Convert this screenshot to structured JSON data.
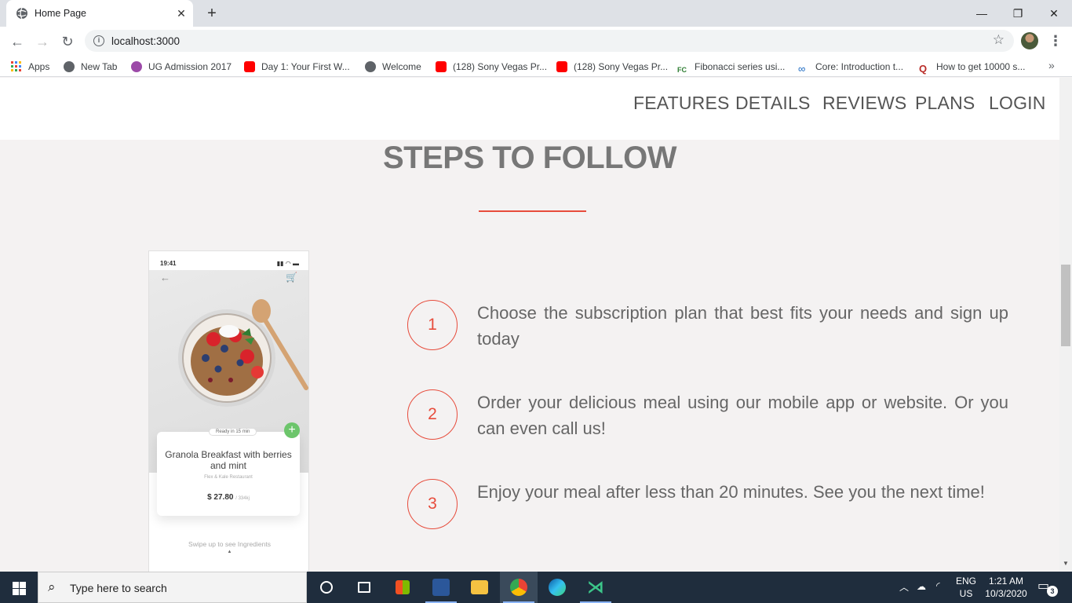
{
  "browser": {
    "tab_title": "Home Page",
    "new_tab_symbol": "+",
    "url": "localhost:3000",
    "bookmarks": [
      {
        "label": "Apps",
        "icon": "apps-grid-icon",
        "color": "#e94235"
      },
      {
        "label": "New Tab",
        "icon": "globe-icon",
        "color": "#5f6368"
      },
      {
        "label": "UG Admission 2017",
        "icon": "university-icon",
        "color": "#9c27b0"
      },
      {
        "label": "Day 1: Your First W...",
        "icon": "youtube-icon",
        "color": "#ff0000"
      },
      {
        "label": "Welcome",
        "icon": "globe-icon",
        "color": "#5f6368"
      },
      {
        "label": "(128) Sony Vegas Pr...",
        "icon": "youtube-icon",
        "color": "#ff0000"
      },
      {
        "label": "(128) Sony Vegas Pr...",
        "icon": "youtube-icon",
        "color": "#ff0000"
      },
      {
        "label": "Fibonacci series usi...",
        "icon": "fc-icon",
        "color": "#2e7d32"
      },
      {
        "label": "Core: Introduction t...",
        "icon": "infinity-icon",
        "color": "#1565c0"
      },
      {
        "label": "How to get 10000 s...",
        "icon": "quora-icon",
        "color": "#b92b27"
      }
    ]
  },
  "site": {
    "nav": [
      "FEATURES",
      "DETAILS",
      "REVIEWS",
      "PLANS",
      "LOGIN"
    ],
    "section_title": "STEPS TO FOLLOW",
    "accent_color": "#e74c3c",
    "phone": {
      "time": "19:41",
      "ready": "Ready in 15 min",
      "dish": "Granola Breakfast with berries and mint",
      "restaurant": "Flex & Kale Restaurant",
      "price": "$ 27.80",
      "kcal": "/ 334kj",
      "swipe": "Swipe up to see Ingredients"
    },
    "steps": [
      {
        "number": "1",
        "text": "Choose the subscription plan that best fits your needs and sign up today"
      },
      {
        "number": "2",
        "text": "Order your delicious meal using our mobile app or website. Or you can even call us!"
      },
      {
        "number": "3",
        "text": "Enjoy your meal after less than 20 minutes. See you the next time!"
      }
    ]
  },
  "taskbar": {
    "search_placeholder": "Type here to search",
    "lang_line1": "ENG",
    "lang_line2": "US",
    "time": "1:21 AM",
    "date": "10/3/2020",
    "notification_count": "3"
  }
}
